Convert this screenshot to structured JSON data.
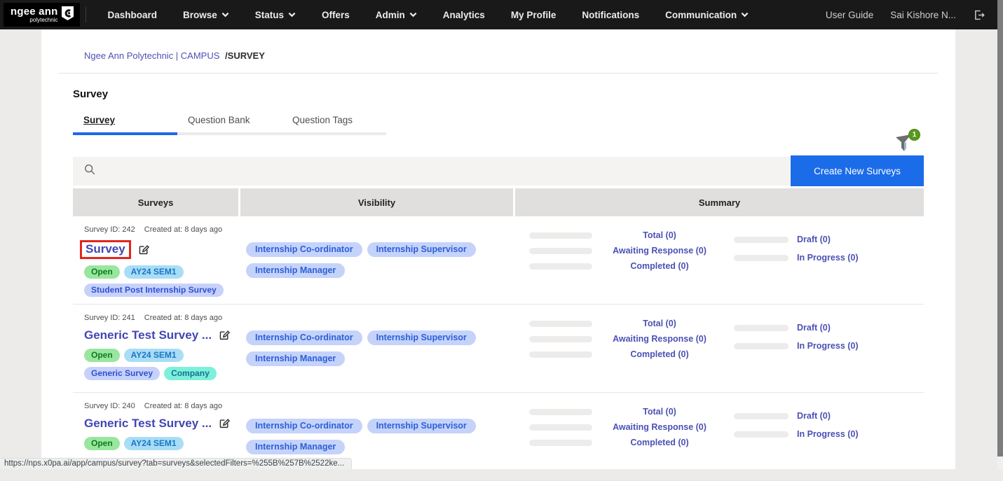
{
  "navbar": {
    "logo": {
      "line1": "ngee ann",
      "line2": "polytechnic"
    },
    "items": [
      {
        "label": "Dashboard",
        "caret": false
      },
      {
        "label": "Browse",
        "caret": true
      },
      {
        "label": "Status",
        "caret": true
      },
      {
        "label": "Offers",
        "caret": false
      },
      {
        "label": "Admin",
        "caret": true
      },
      {
        "label": "Analytics",
        "caret": false
      },
      {
        "label": "My Profile",
        "caret": false
      },
      {
        "label": "Notifications",
        "caret": false
      },
      {
        "label": "Communication",
        "caret": true
      }
    ],
    "right": {
      "user_guide": "User Guide",
      "username": "Sai Kishore N...",
      "logout_icon": "logout-icon"
    }
  },
  "breadcrumb": {
    "left": "Ngee Ann Polytechnic | CAMPUS",
    "current": "/SURVEY"
  },
  "page": {
    "title": "Survey"
  },
  "tabs": [
    {
      "label": "Survey",
      "active": true
    },
    {
      "label": "Question Bank",
      "active": false
    },
    {
      "label": "Question Tags",
      "active": false
    }
  ],
  "filter": {
    "icon": "filter-funnel-icon",
    "badge_count": "1"
  },
  "toolbar": {
    "search_icon": "search-icon",
    "create_button_label": "Create New Surveys"
  },
  "table": {
    "headers": [
      "Surveys",
      "Visibility",
      "Summary"
    ],
    "rows": [
      {
        "id_label": "Survey ID: 242",
        "created_label": "Created at: 8 days ago",
        "title": "Survey",
        "highlighted": true,
        "status_badges": [
          {
            "label": "Open",
            "type": "green"
          },
          {
            "label": "AY24 SEM1",
            "type": "blue"
          },
          {
            "label": "Student Post Internship Survey",
            "type": "periwinkle"
          }
        ],
        "visibility": [
          "Internship Co-ordinator",
          "Internship Supervisor",
          "Internship Manager"
        ],
        "summary_left": [
          "Total (0)",
          "Awaiting Response (0)",
          "Completed (0)"
        ],
        "summary_right": [
          "Draft (0)",
          "In Progress (0)"
        ]
      },
      {
        "id_label": "Survey ID: 241",
        "created_label": "Created at: 8 days ago",
        "title": "Generic Test Survey ...",
        "highlighted": false,
        "status_badges": [
          {
            "label": "Open",
            "type": "green"
          },
          {
            "label": "AY24 SEM1",
            "type": "blue"
          },
          {
            "label": "Generic Survey",
            "type": "periwinkle"
          },
          {
            "label": "Company",
            "type": "teal"
          }
        ],
        "visibility": [
          "Internship Co-ordinator",
          "Internship Supervisor",
          "Internship Manager"
        ],
        "summary_left": [
          "Total (0)",
          "Awaiting Response (0)",
          "Completed (0)"
        ],
        "summary_right": [
          "Draft (0)",
          "In Progress (0)"
        ]
      },
      {
        "id_label": "Survey ID: 240",
        "created_label": "Created at: 8 days ago",
        "title": "Generic Test Survey ...",
        "highlighted": false,
        "status_badges": [
          {
            "label": "Open",
            "type": "green"
          },
          {
            "label": "AY24 SEM1",
            "type": "blue"
          }
        ],
        "visibility": [
          "Internship Co-ordinator",
          "Internship Supervisor",
          "Internship Manager"
        ],
        "summary_left": [
          "Total (0)",
          "Awaiting Response (0)",
          "Completed (0)"
        ],
        "summary_right": [
          "Draft (0)",
          "In Progress (0)"
        ]
      }
    ]
  },
  "statusbar": {
    "url": "https://nps.x0pa.ai/app/campus/survey?tab=surveys&selectedFilters=%255B%257B%2522ke..."
  },
  "colors": {
    "navbar_bg": "#191919",
    "page_bg": "#ecebe9",
    "accent_blue": "#1b6ce9",
    "tab_underline": "#2167e8",
    "title_indigo": "#4145b4",
    "highlight_red": "#e3251c",
    "filter_badge_green": "#58991d"
  }
}
